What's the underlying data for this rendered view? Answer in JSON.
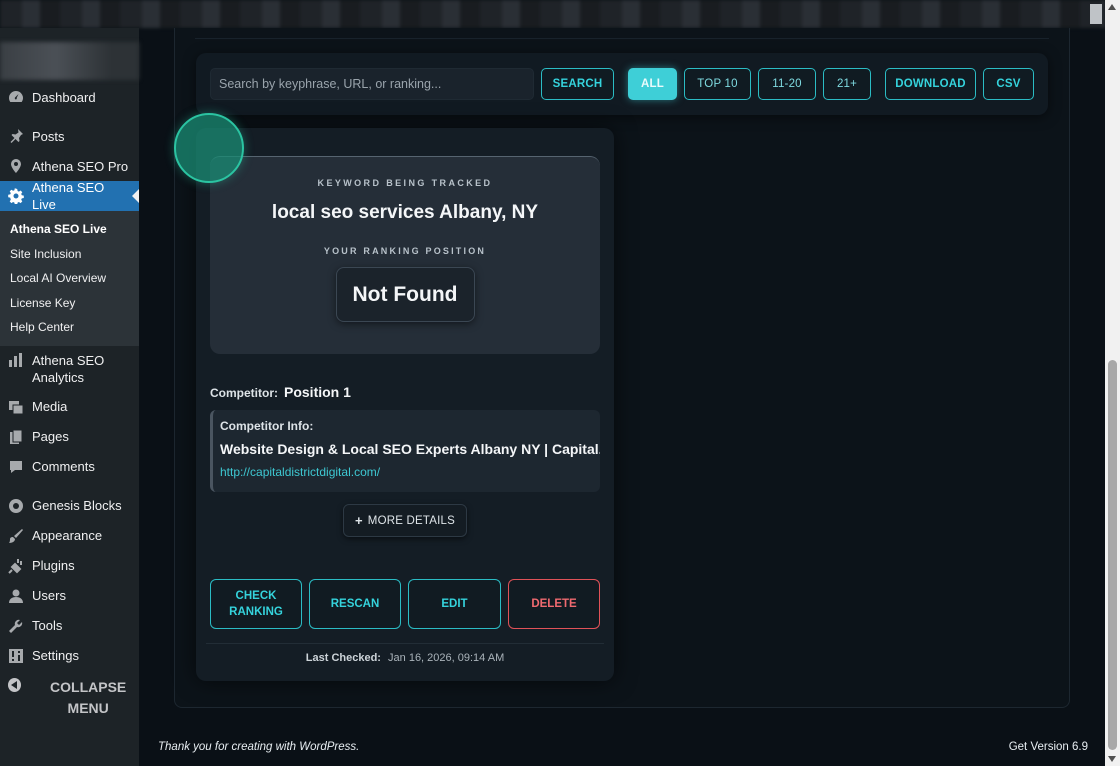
{
  "sidebar": {
    "items": [
      {
        "label": "Dashboard",
        "icon": "dashboard-icon"
      },
      {
        "label": "Posts",
        "icon": "pin-icon"
      },
      {
        "label": "Athena SEO Pro",
        "icon": "location-pin-icon"
      },
      {
        "label": "Athena SEO Live",
        "icon": "gear-icon",
        "active": true
      }
    ],
    "submenu": [
      "Athena SEO Live",
      "Site Inclusion",
      "Local AI Overview",
      "License Key",
      "Help Center"
    ],
    "items_after": [
      {
        "label": "Athena SEO Analytics",
        "icon": "bar-chart-icon"
      },
      {
        "label": "Media",
        "icon": "media-icon"
      },
      {
        "label": "Pages",
        "icon": "pages-icon"
      },
      {
        "label": "Comments",
        "icon": "comment-icon"
      },
      {
        "label": "Genesis Blocks",
        "icon": "genesis-icon"
      },
      {
        "label": "Appearance",
        "icon": "brush-icon"
      },
      {
        "label": "Plugins",
        "icon": "plug-icon"
      },
      {
        "label": "Users",
        "icon": "user-icon"
      },
      {
        "label": "Tools",
        "icon": "wrench-icon"
      },
      {
        "label": "Settings",
        "icon": "settings-icon"
      }
    ],
    "collapse_label": "COLLAPSE MENU"
  },
  "toolbar": {
    "search_placeholder": "Search by keyphrase, URL, or ranking...",
    "search_label": "SEARCH",
    "filters": [
      "ALL",
      "TOP 10",
      "11-20",
      "21+"
    ],
    "active_filter": "ALL",
    "download_label": "DOWNLOAD",
    "csv_label": "CSV"
  },
  "card": {
    "keyword_label": "KEYWORD BEING TRACKED",
    "keyword": "local seo services Albany, NY",
    "ranking_label": "YOUR RANKING POSITION",
    "ranking": "Not Found",
    "competitor_label": "Competitor:",
    "competitor_position": "Position 1",
    "competitor_info_label": "Competitor Info:",
    "competitor_title": "Website Design & Local SEO Experts Albany NY | Capital...",
    "competitor_url": "http://capitaldistrictdigital.com/",
    "more_details_label": "MORE DETAILS",
    "actions": {
      "check_ranking": "CHECK RANKING",
      "rescan": "RESCAN",
      "edit": "EDIT",
      "delete": "DELETE"
    },
    "last_checked_label": "Last Checked:",
    "last_checked_value": "Jan 16, 2026, 09:14 AM"
  },
  "footer": {
    "thanks": "Thank you for creating with WordPress.",
    "version": "Get Version 6.9"
  },
  "colors": {
    "accent": "#35d3dc",
    "danger": "#f06a70",
    "wp_active": "#2271b1",
    "sidebar_bg": "#1d2327"
  }
}
